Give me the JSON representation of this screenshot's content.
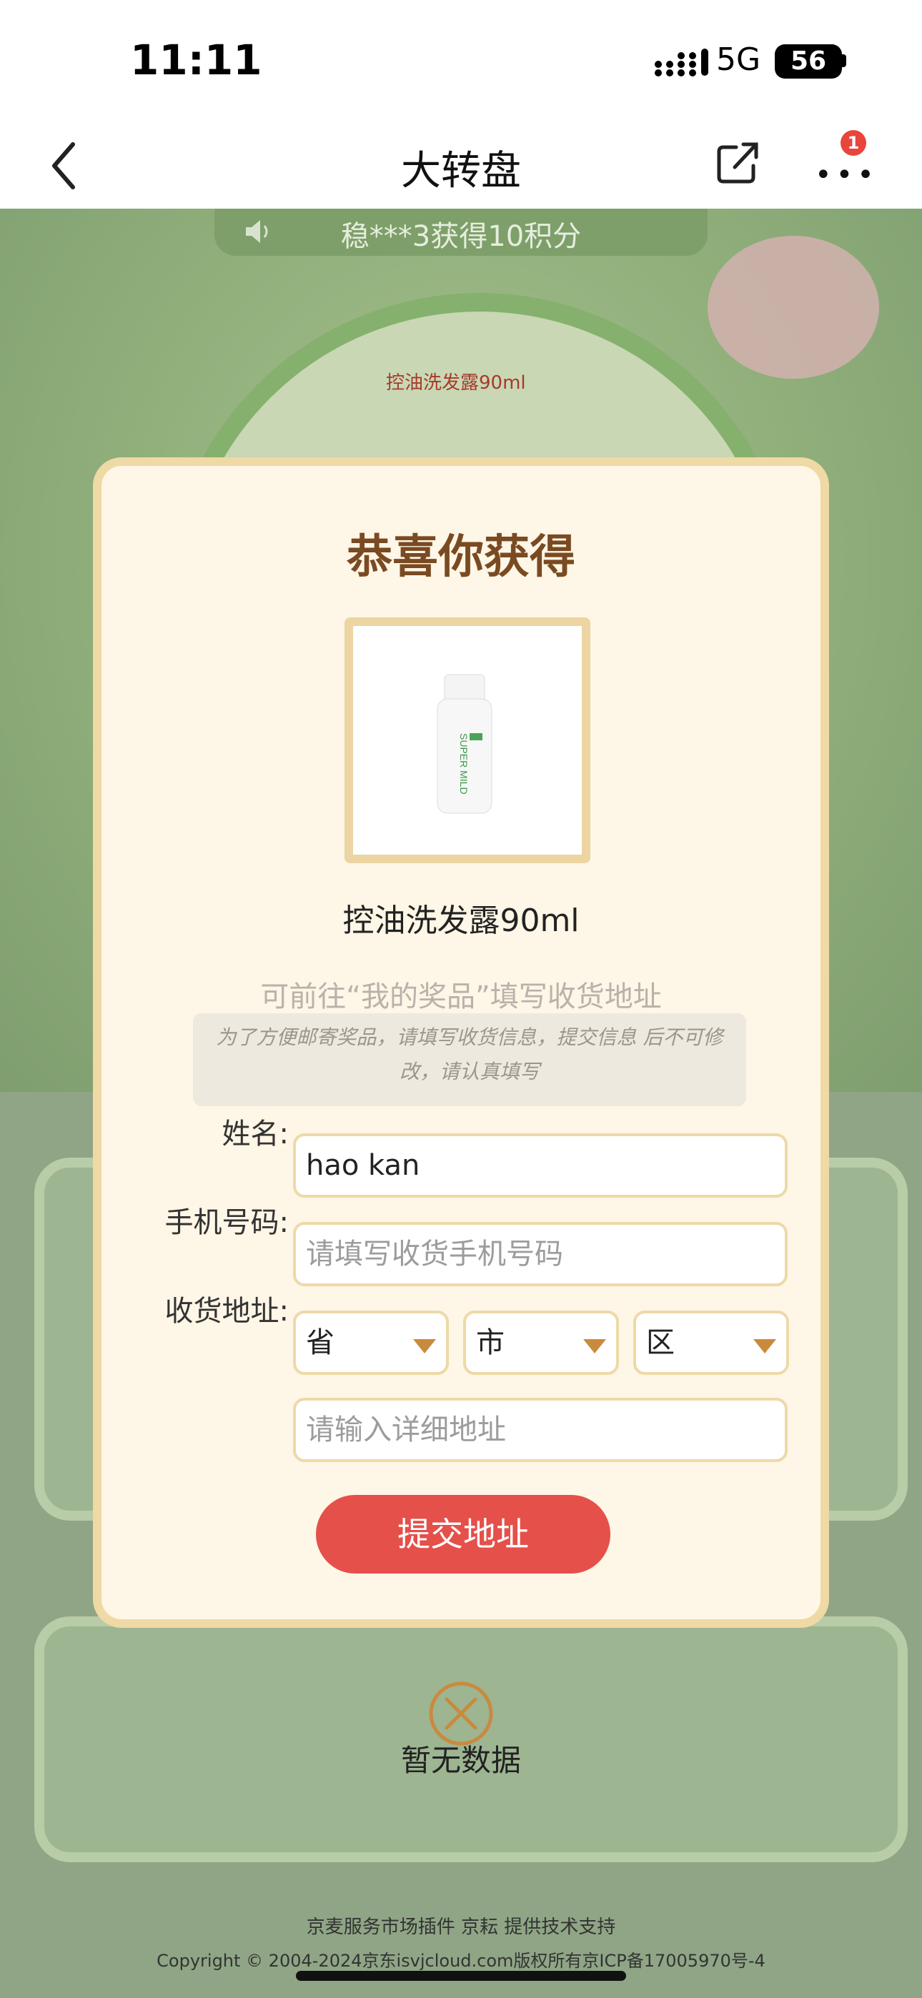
{
  "status_bar": {
    "time": "11:11",
    "network": "5G",
    "battery": "56"
  },
  "nav": {
    "title": "大转盘",
    "badge_count": "1"
  },
  "background": {
    "notice": "稳***3获得10积分",
    "wheel_prize": "控油洗发露90ml",
    "empty_text": "暂无数据",
    "footer_line1": "京麦服务市场插件 京耘 提供技术支持",
    "footer_line2": "Copyright © 2004-2024京东isvjcloud.com版权所有京ICP备17005970号-4"
  },
  "modal": {
    "title": "恭喜你获得",
    "prize_name": "控油洗发露90ml",
    "hint": "可前往“我的奖品”填写收货地址",
    "note": "为了方便邮寄奖品，请填写收货信息，提交信息 后不可修改，请认真填写",
    "form": {
      "name_label": "姓名:",
      "name_value": "hao kan",
      "phone_label": "手机号码:",
      "phone_placeholder": "请填写收货手机号码",
      "address_label": "收货地址:",
      "province": "省",
      "city": "市",
      "district": "区",
      "detail_placeholder": "请输入详细地址"
    },
    "submit_label": "提交地址"
  },
  "colors": {
    "accent": "#e5504a",
    "title_brown": "#7a4a22",
    "frame": "#efd9a4"
  }
}
